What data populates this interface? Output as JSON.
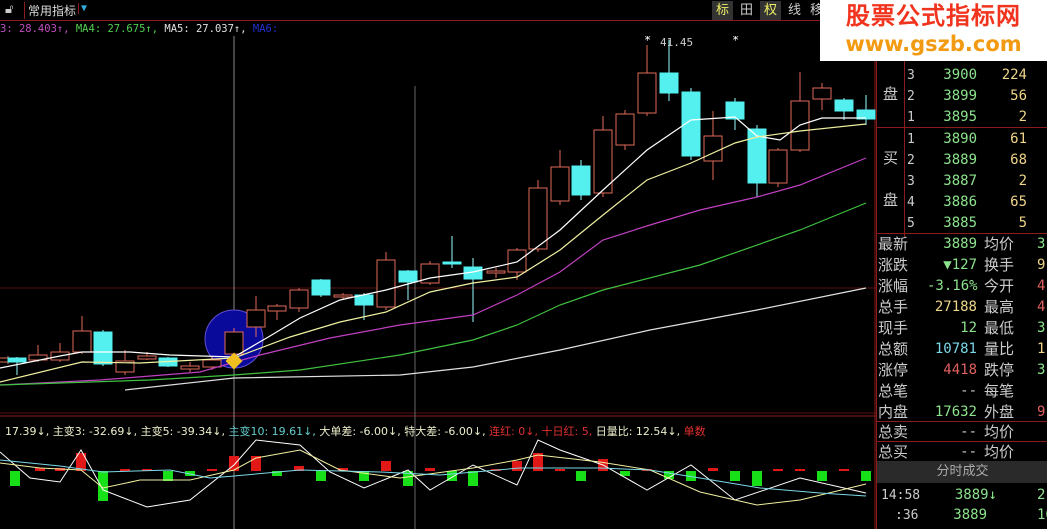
{
  "toolbar": {
    "indicator_select": "常用指标",
    "buttons": [
      "标",
      "田",
      "权",
      "线",
      "移"
    ]
  },
  "ma_legend": [
    {
      "text": "3: 28.403↑, ",
      "color": "#c050c0"
    },
    {
      "text": "MA4: 27.675↑, ",
      "color": "#50d050"
    },
    {
      "text": "MA5: 27.037↑, ",
      "color": "#e0e0e0"
    },
    {
      "text": "MA6:",
      "color": "#2030d0"
    }
  ],
  "chart": {
    "high_label": "41.45"
  },
  "indicator_legend": [
    {
      "text": "17.39↓, ",
      "color": "#eeeecc"
    },
    {
      "text": "主变3: -32.69↓, ",
      "color": "#eeeecc"
    },
    {
      "text": "主变5: -39.34↓, ",
      "color": "#eeeecc"
    },
    {
      "text": "主变10: 19.61↓, ",
      "color": "#6cc"
    },
    {
      "text": "大单差: -6.00↓, ",
      "color": "#eeeecc"
    },
    {
      "text": "特大差: -6.00↓, ",
      "color": "#eeeecc"
    },
    {
      "text": "连红: 0↓, ",
      "color": "#e03030"
    },
    {
      "text": "十日红: 5, ",
      "color": "#e03030"
    },
    {
      "text": "日量比: 12.54↓, ",
      "color": "#eeeecc"
    },
    {
      "text": "单数",
      "color": "#e03030"
    }
  ],
  "watermark": {
    "title": "股票公式指标网",
    "url": "www.gszb.com"
  },
  "quotes": {
    "sell_label": "盘",
    "buy_label_1": "买",
    "buy_label_2": "盘",
    "sell": [
      {
        "n": "3",
        "price": "3900",
        "vol": "224"
      },
      {
        "n": "2",
        "price": "3899",
        "vol": "56"
      },
      {
        "n": "1",
        "price": "3895",
        "vol": "2"
      }
    ],
    "buy": [
      {
        "n": "1",
        "price": "3890",
        "vol": "61"
      },
      {
        "n": "2",
        "price": "3889",
        "vol": "68"
      },
      {
        "n": "3",
        "price": "3887",
        "vol": "2"
      },
      {
        "n": "4",
        "price": "3886",
        "vol": "65"
      },
      {
        "n": "5",
        "price": "3885",
        "vol": "5"
      }
    ]
  },
  "stats": [
    {
      "l": "最新",
      "v": "3889",
      "vc": "#8de38d",
      "l2": "均价",
      "v2": "3",
      "v2c": "#8de38d"
    },
    {
      "l": "涨跌",
      "v": "▼127",
      "vc": "#8de38d",
      "l2": "换手",
      "v2": "9.",
      "v2c": "#eed58a"
    },
    {
      "l": "涨幅",
      "v": "-3.16%",
      "vc": "#8de38d",
      "l2": "今开",
      "v2": "4",
      "v2c": "#e06060"
    },
    {
      "l": "总手",
      "v": "27188",
      "vc": "#eed58a",
      "l2": "最高",
      "v2": "4",
      "v2c": "#e06060"
    },
    {
      "l": "现手",
      "v": "12",
      "vc": "#8de38d",
      "l2": "最低",
      "v2": "3",
      "v2c": "#8de38d"
    },
    {
      "l": "总额",
      "v": "10781",
      "vc": "#7cd8e8",
      "l2": "量比",
      "v2": "1",
      "v2c": "#eed58a"
    },
    {
      "l": "涨停",
      "v": "4418",
      "vc": "#e06060",
      "l2": "跌停",
      "v2": "3",
      "v2c": "#8de38d"
    },
    {
      "l": "总笔",
      "v": "--",
      "vc": "#ccc",
      "l2": "每笔",
      "v2": "",
      "v2c": "#ccc"
    },
    {
      "l": "内盘",
      "v": "17632",
      "vc": "#8de38d",
      "l2": "外盘",
      "v2": "9",
      "v2c": "#e06060"
    },
    {
      "l": "总卖",
      "v": "--",
      "vc": "#ccc",
      "l2": "均价",
      "v2": "",
      "v2c": "#ccc"
    },
    {
      "l": "总买",
      "v": "--",
      "vc": "#ccc",
      "l2": "均价",
      "v2": "",
      "v2c": "#ccc"
    }
  ],
  "ticks": {
    "title": "分时成交",
    "rows": [
      {
        "time": "14:58",
        "price": "3889↓",
        "vol": "2"
      },
      {
        "time": ":36",
        "price": "3889",
        "vol": "16"
      }
    ]
  }
}
